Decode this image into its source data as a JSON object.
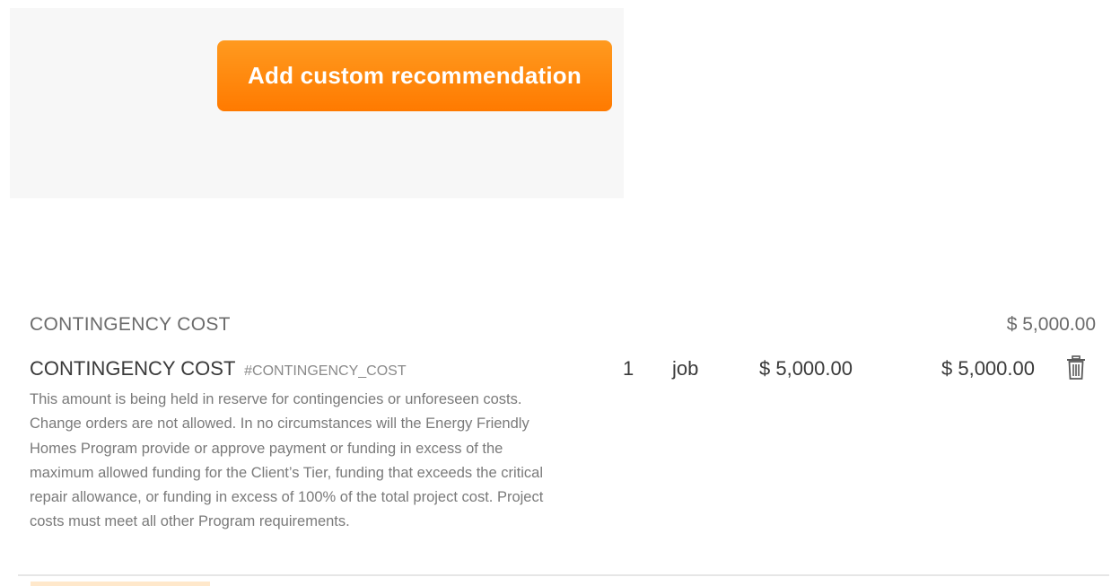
{
  "toolbar": {
    "add_custom_label": "Add custom recommendation"
  },
  "category": {
    "title": "CONTINGENCY COST",
    "total": "$ 5,000.00"
  },
  "item": {
    "name": "CONTINGENCY COST",
    "code": "#CONTINGENCY_COST",
    "description": "This amount is being held in reserve for contingencies or unforeseen costs. Change orders are not allowed. In no circumstances will the Energy Friendly Homes Program provide or approve payment or funding in excess of the maximum allowed funding for the Client’s Tier, funding that exceeds the critical repair allowance, or funding in excess of 100% of the total project cost. Project costs must meet all other Program requirements.",
    "quantity": "1",
    "unit": "job",
    "unit_price": "$ 5,000.00",
    "line_total": "$ 5,000.00",
    "delete_icon": "trash-icon"
  },
  "colors": {
    "accent": "#ff8a0f",
    "panel_bg": "#f7f7f7",
    "text_dark": "#3a3a3a",
    "text_muted": "#7a7a7a"
  }
}
